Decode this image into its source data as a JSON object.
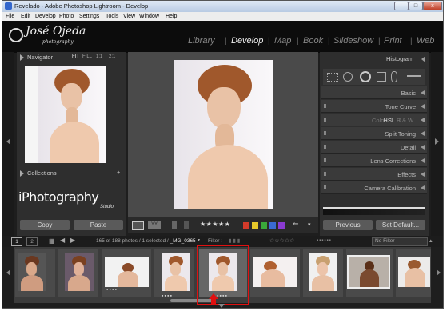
{
  "window": {
    "title": "Revelado - Adobe Photoshop Lightroom - Develop",
    "minimize": "–",
    "maximize": "□",
    "close": "x"
  },
  "menu": [
    "File",
    "Edit",
    "Develop",
    "Photo",
    "Settings",
    "Tools",
    "View",
    "Window",
    "Help"
  ],
  "identity": {
    "name": "José Ojeda",
    "tagline": "photography"
  },
  "modules": [
    "Library",
    "Develop",
    "Map",
    "Book",
    "Slideshow",
    "Print",
    "Web"
  ],
  "navigator": {
    "title": "Navigator",
    "zoom_options": [
      "FIT",
      "FILL",
      "1:1",
      "2:1"
    ]
  },
  "collections": {
    "title": "Collections",
    "minus": "–",
    "plus": "+"
  },
  "watermark": {
    "text": "iPhotography",
    "sub": "Studio"
  },
  "left_buttons": {
    "copy": "Copy",
    "paste": "Paste"
  },
  "right_panel": {
    "histogram": "Histogram",
    "sections": [
      "Basic",
      "Tone Curve",
      "HSL / Color / B & W",
      "Split Toning",
      "Detail",
      "Lens Corrections",
      "Effects",
      "Camera Calibration"
    ],
    "hsl_parts": [
      "HSL",
      "Color",
      "B & W"
    ],
    "previous": "Previous",
    "set_default": "Set Default..."
  },
  "toolbar": {
    "stars": "★★★★★",
    "color_labels": [
      "#d23a2a",
      "#e6c92a",
      "#3aa83a",
      "#3a6ad2",
      "#8a3ad2"
    ]
  },
  "filmstrip_bar": {
    "page1": "1",
    "page2": "2",
    "status_prefix": "165 of 188 photos / 1 selected / ",
    "filename": "_MG_0365-",
    "filter_label": "Filter :",
    "filter_value": "No Filter",
    "stars": "☆☆☆☆☆"
  },
  "filmstrip": {
    "dots": [
      "● ● ● ●",
      "● ● ● ●",
      "● ● ● ●"
    ]
  }
}
